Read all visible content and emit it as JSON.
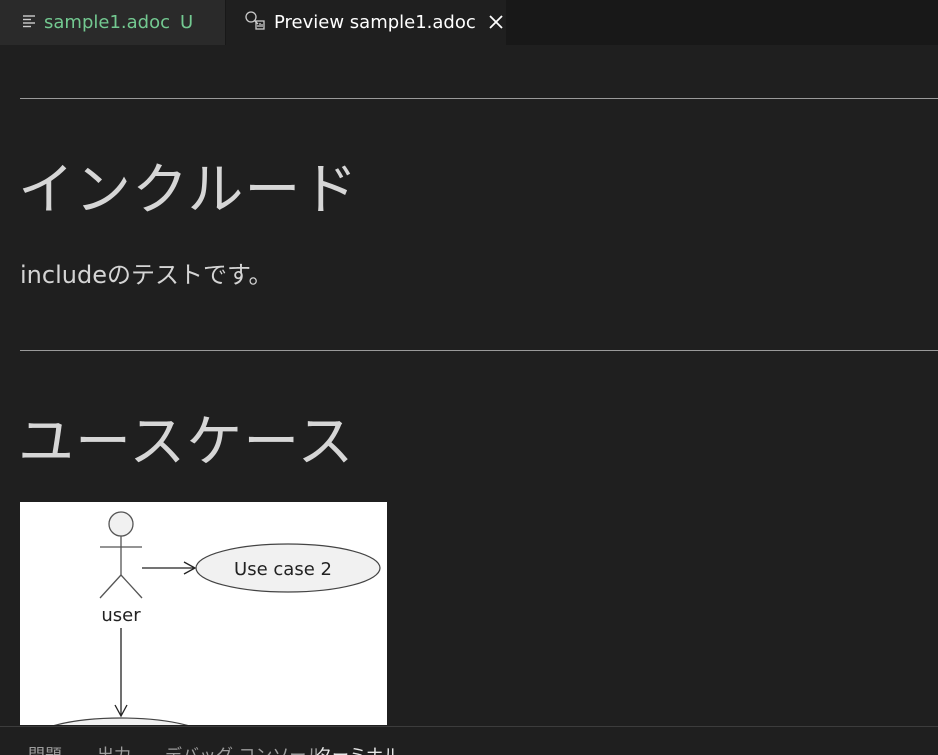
{
  "editor_tabs": [
    {
      "label": "sample1.adoc",
      "status": "U",
      "icon": "lines-icon",
      "color": "#73c991"
    },
    {
      "label": "Preview sample1.adoc",
      "icon": "preview-icon",
      "close_icon": "close-icon"
    }
  ],
  "document": {
    "section1": {
      "heading": "インクルード",
      "text": "includeのテストです。"
    },
    "section2": {
      "heading": "ユースケース"
    }
  },
  "diagram": {
    "actor_label": "user",
    "usecase_label": "Use case 2"
  },
  "panel_tabs": [
    "問題",
    "出力",
    "デバッグ コンソール",
    "ターミナル"
  ],
  "colors": {
    "background": "#1f1f1f",
    "tab_inactive": "#2a2a2a",
    "modified_green": "#73c991"
  }
}
